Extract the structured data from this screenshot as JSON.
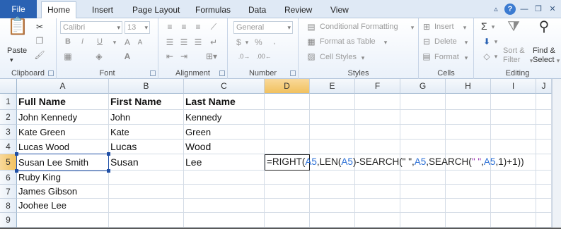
{
  "tabs": {
    "file": "File",
    "items": [
      "Home",
      "Insert",
      "Page Layout",
      "Formulas",
      "Data",
      "Review",
      "View"
    ],
    "active": "Home"
  },
  "ribbon": {
    "clipboard": {
      "label": "Clipboard",
      "paste": "Paste"
    },
    "font": {
      "label": "Font",
      "name": "Calibri",
      "size": "13",
      "bold": "B",
      "italic": "I",
      "underline": "U"
    },
    "alignment": {
      "label": "Alignment"
    },
    "number": {
      "label": "Number",
      "format": "General",
      "currency": "$",
      "percent": "%"
    },
    "styles": {
      "label": "Styles",
      "conditional": "Conditional Formatting",
      "format_table": "Format as Table",
      "cell_styles": "Cell Styles"
    },
    "cells": {
      "label": "Cells",
      "insert": "Insert",
      "delete": "Delete",
      "format": "Format"
    },
    "editing": {
      "label": "Editing",
      "sigma": "Σ",
      "sort": "Sort &",
      "filter": "Filter",
      "find": "Find &",
      "select": "Select"
    }
  },
  "sheet": {
    "columns": [
      "A",
      "B",
      "C",
      "D",
      "E",
      "F",
      "G",
      "H",
      "I",
      "J"
    ],
    "rows": [
      "1",
      "2",
      "3",
      "4",
      "5",
      "6",
      "7",
      "8",
      "9"
    ],
    "selected_column": "D",
    "selected_row": "5",
    "headers": {
      "a1": "Full Name",
      "b1": "First Name",
      "c1": "Last Name"
    },
    "data": [
      {
        "a": "John Kennedy",
        "b": "John",
        "c": "Kennedy"
      },
      {
        "a": "Kate Green",
        "b": "Kate",
        "c": "Green"
      },
      {
        "a": "Lucas Wood",
        "b": "Lucas",
        "c": "Wood"
      },
      {
        "a": "Susan Lee Smith",
        "b": "Susan",
        "c": "Lee"
      },
      {
        "a": "Ruby King",
        "b": "",
        "c": ""
      },
      {
        "a": "James Gibson",
        "b": "",
        "c": ""
      },
      {
        "a": "Joohee Lee",
        "b": "",
        "c": ""
      }
    ],
    "formula": {
      "t1": "=RIGHT(",
      "r1": "A5",
      "t2": ",LEN(",
      "r2": "A5",
      "t3": ")-SEARCH(\" \",",
      "r3": "A5",
      "t4": ",SEARCH(",
      "p1": "\" \"",
      "t5": ",",
      "r4": "A5",
      "t6": ",1)+1))"
    }
  }
}
